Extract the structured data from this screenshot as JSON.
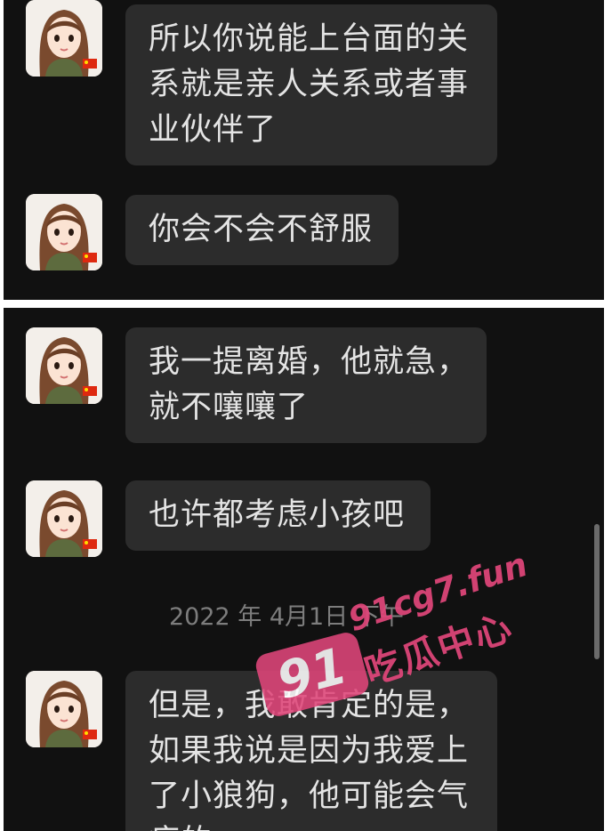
{
  "messages": [
    {
      "text": "所以你说能上台面的关\n系就是亲人关系或者事\n业伙伴了"
    },
    {
      "text": "你会不会不舒服"
    },
    {
      "text": "我一提离婚，他就急，\n就不嚷嚷了"
    },
    {
      "text": "也许都考虑小孩吧"
    },
    {
      "text": "但是，我敢肯定的是，\n如果我说是因为我爱上\n了小狼狗，他可能会气\n疯的"
    }
  ],
  "timestamp": "2022 年 4月1日 下午",
  "watermark": {
    "badge": "91",
    "url": "91cg7.fun",
    "name": "吃瓜中心",
    "color": "#e0467a"
  },
  "avatar_icon": "cartoon-woman-avatar-with-china-flag",
  "colors": {
    "background": "#111111",
    "bubble": "#2c2c2c",
    "text": "#e4e4e4",
    "divider": "#ffffff"
  }
}
